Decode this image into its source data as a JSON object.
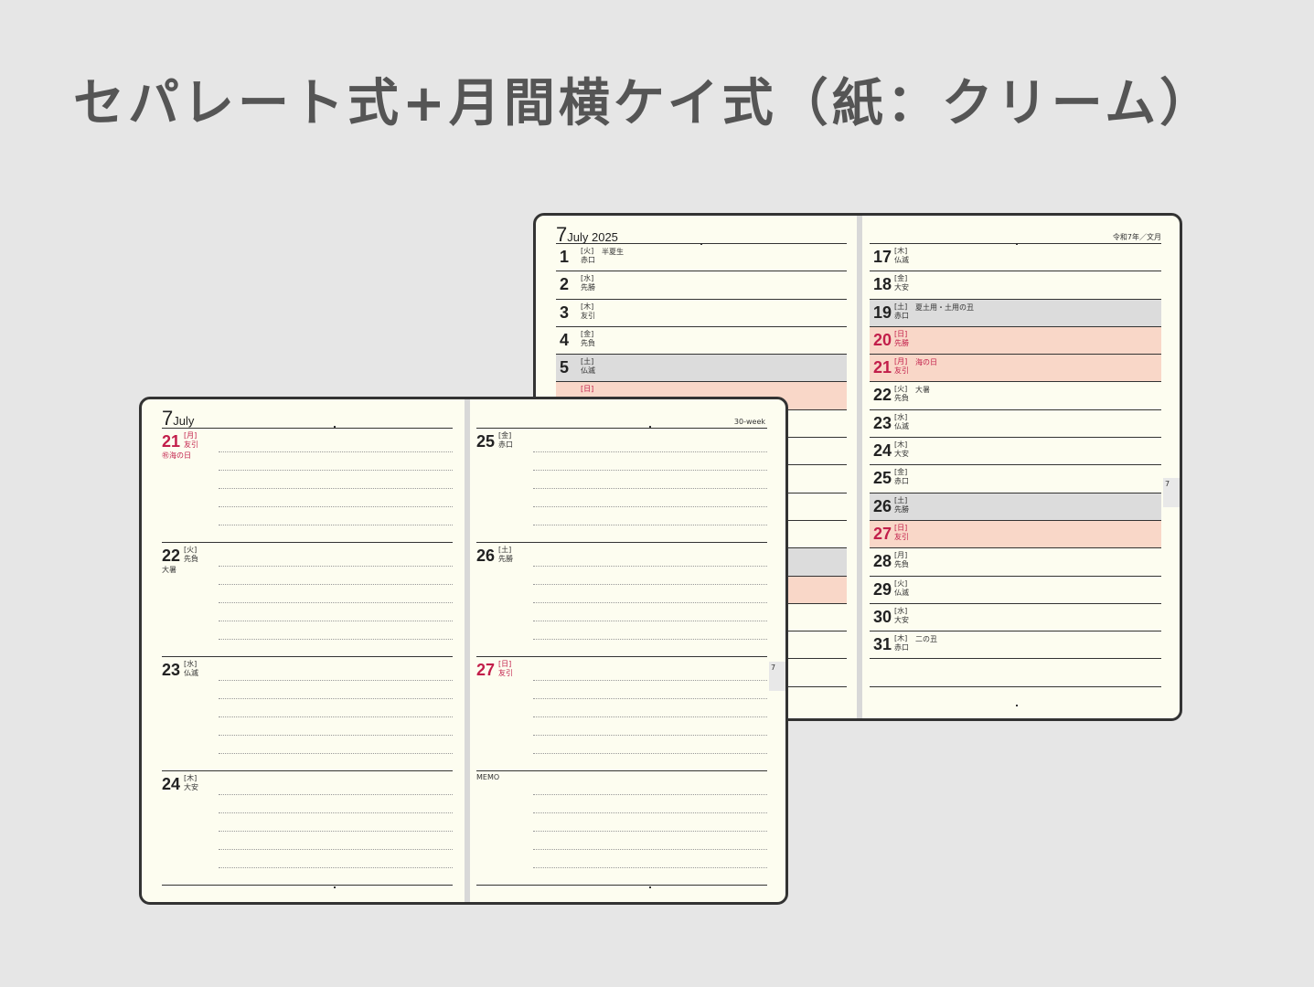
{
  "title": "セパレート式+月間横ケイ式（紙：クリーム）",
  "monthly": {
    "month_number": "7",
    "month_label": "July 2025",
    "era_label": "令和7年／文月",
    "tab_label": "7",
    "left_rows": [
      {
        "day": "1",
        "weekday": "[火]",
        "rokuyo": "赤口",
        "note": "半夏生",
        "type": "normal"
      },
      {
        "day": "2",
        "weekday": "[水]",
        "rokuyo": "先勝",
        "note": "",
        "type": "normal"
      },
      {
        "day": "3",
        "weekday": "[木]",
        "rokuyo": "友引",
        "note": "",
        "type": "normal"
      },
      {
        "day": "4",
        "weekday": "[金]",
        "rokuyo": "先負",
        "note": "",
        "type": "normal"
      },
      {
        "day": "5",
        "weekday": "[土]",
        "rokuyo": "仏滅",
        "note": "",
        "type": "sat"
      },
      {
        "day": "",
        "weekday": "[日]",
        "rokuyo": "",
        "note": "",
        "type": "hol"
      },
      {
        "day": "",
        "weekday": "",
        "rokuyo": "",
        "note": "",
        "type": "normal"
      },
      {
        "day": "",
        "weekday": "",
        "rokuyo": "",
        "note": "",
        "type": "normal"
      },
      {
        "day": "",
        "weekday": "",
        "rokuyo": "",
        "note": "",
        "type": "normal"
      },
      {
        "day": "",
        "weekday": "",
        "rokuyo": "",
        "note": "",
        "type": "normal"
      },
      {
        "day": "",
        "weekday": "",
        "rokuyo": "",
        "note": "",
        "type": "normal"
      },
      {
        "day": "",
        "weekday": "",
        "rokuyo": "",
        "note": "",
        "type": "sat"
      },
      {
        "day": "",
        "weekday": "",
        "rokuyo": "",
        "note": "",
        "type": "hol"
      },
      {
        "day": "",
        "weekday": "",
        "rokuyo": "",
        "note": "",
        "type": "normal"
      },
      {
        "day": "",
        "weekday": "",
        "rokuyo": "",
        "note": "",
        "type": "normal"
      },
      {
        "day": "",
        "weekday": "",
        "rokuyo": "",
        "note": "",
        "type": "normal"
      }
    ],
    "right_rows": [
      {
        "day": "17",
        "weekday": "[木]",
        "rokuyo": "仏滅",
        "note": "",
        "type": "normal"
      },
      {
        "day": "18",
        "weekday": "[金]",
        "rokuyo": "大安",
        "note": "",
        "type": "normal"
      },
      {
        "day": "19",
        "weekday": "[土]",
        "rokuyo": "赤口",
        "note": "夏土用・土用の丑",
        "type": "sat"
      },
      {
        "day": "20",
        "weekday": "[日]",
        "rokuyo": "先勝",
        "note": "",
        "type": "hol"
      },
      {
        "day": "21",
        "weekday": "[月]",
        "rokuyo": "友引",
        "note": "海の日",
        "type": "hol"
      },
      {
        "day": "22",
        "weekday": "[火]",
        "rokuyo": "先負",
        "note": "大暑",
        "type": "normal"
      },
      {
        "day": "23",
        "weekday": "[水]",
        "rokuyo": "仏滅",
        "note": "",
        "type": "normal"
      },
      {
        "day": "24",
        "weekday": "[木]",
        "rokuyo": "大安",
        "note": "",
        "type": "normal"
      },
      {
        "day": "25",
        "weekday": "[金]",
        "rokuyo": "赤口",
        "note": "",
        "type": "normal"
      },
      {
        "day": "26",
        "weekday": "[土]",
        "rokuyo": "先勝",
        "note": "",
        "type": "sat"
      },
      {
        "day": "27",
        "weekday": "[日]",
        "rokuyo": "友引",
        "note": "",
        "type": "hol"
      },
      {
        "day": "28",
        "weekday": "[月]",
        "rokuyo": "先負",
        "note": "",
        "type": "normal"
      },
      {
        "day": "29",
        "weekday": "[火]",
        "rokuyo": "仏滅",
        "note": "",
        "type": "normal"
      },
      {
        "day": "30",
        "weekday": "[水]",
        "rokuyo": "大安",
        "note": "",
        "type": "normal"
      },
      {
        "day": "31",
        "weekday": "[木]",
        "rokuyo": "赤口",
        "note": "二の丑",
        "type": "normal"
      },
      {
        "day": "",
        "weekday": "",
        "rokuyo": "",
        "note": "",
        "type": "normal"
      }
    ]
  },
  "weekly": {
    "month_number": "7",
    "month_label": "July",
    "week_label": "30-week",
    "tab_label": "7",
    "left_days": [
      {
        "day": "21",
        "weekday": "[月]",
        "rokuyo": "友引",
        "note": "㊗海の日",
        "type": "hol"
      },
      {
        "day": "22",
        "weekday": "[火]",
        "rokuyo": "先負",
        "note": "大暑",
        "type": "normal"
      },
      {
        "day": "23",
        "weekday": "[水]",
        "rokuyo": "仏滅",
        "note": "",
        "type": "normal"
      },
      {
        "day": "24",
        "weekday": "[木]",
        "rokuyo": "大安",
        "note": "",
        "type": "normal"
      }
    ],
    "right_days": [
      {
        "day": "25",
        "weekday": "[金]",
        "rokuyo": "赤口",
        "note": "",
        "type": "normal"
      },
      {
        "day": "26",
        "weekday": "[土]",
        "rokuyo": "先勝",
        "note": "",
        "type": "normal"
      },
      {
        "day": "27",
        "weekday": "[日]",
        "rokuyo": "友引",
        "note": "",
        "type": "hol"
      }
    ],
    "memo_label": "MEMO"
  },
  "colors": {
    "background": "#e6e6e6",
    "paper": "#fdfdf0",
    "holiday_fill": "#f9d7c8",
    "saturday_fill": "#dcdcdc",
    "holiday_text": "#c21e4a"
  }
}
